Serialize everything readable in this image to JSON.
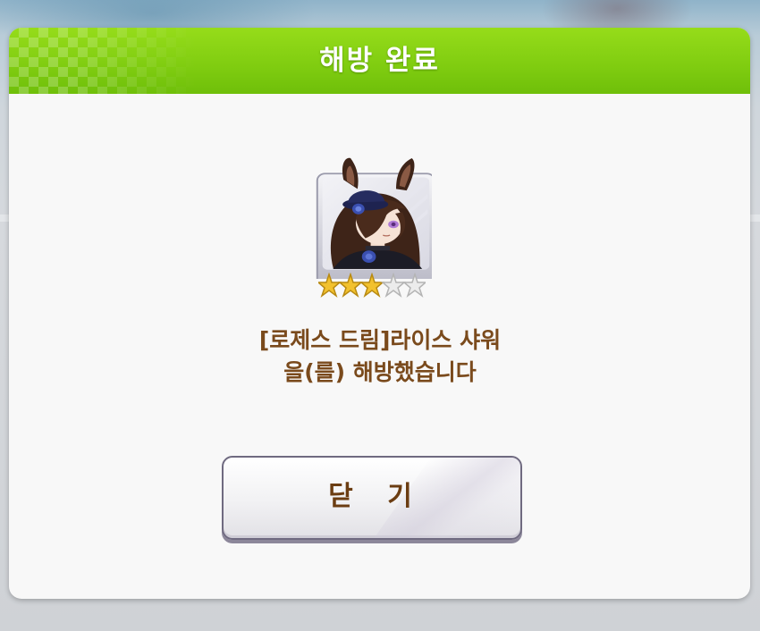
{
  "dialog": {
    "title": "해방 완료",
    "message_line1": "[로제스 드림]라이스 샤워",
    "message_line2": "을(를) 해방했습니다",
    "close_label": "닫 기"
  },
  "character": {
    "rarity_stars_filled": 3,
    "rarity_stars_total": 5
  },
  "colors": {
    "header_green": "#7fcc10",
    "message_brown": "#7a4a1c",
    "star_gold": "#f2c12e",
    "star_empty": "#e6e6e6"
  },
  "icons": [
    "character-portrait-icon",
    "star-icon"
  ]
}
